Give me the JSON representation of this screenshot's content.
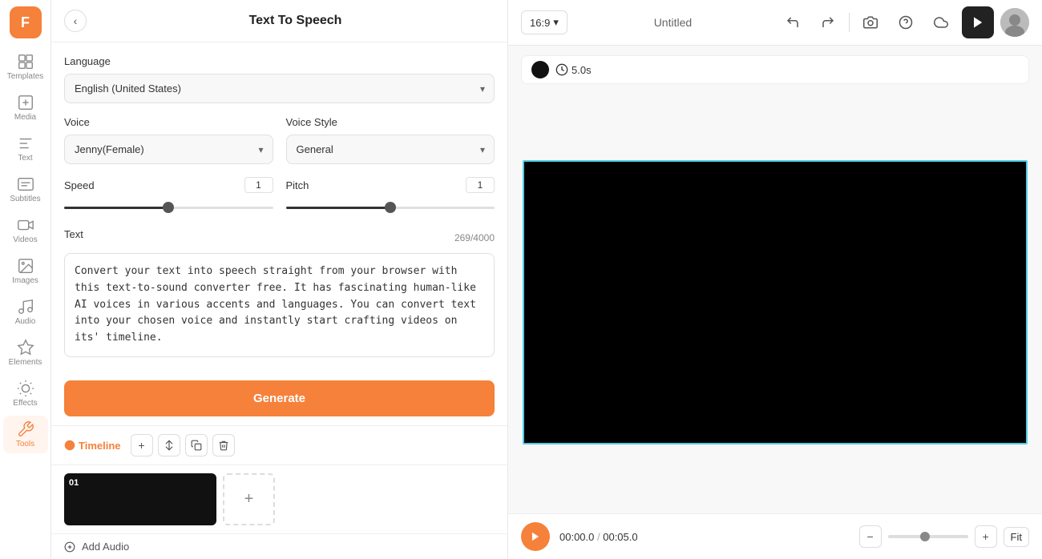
{
  "app": {
    "logo": "F"
  },
  "sidebar": {
    "items": [
      {
        "id": "templates",
        "label": "Templates",
        "icon": "grid"
      },
      {
        "id": "media",
        "label": "Media",
        "icon": "plus-square"
      },
      {
        "id": "text",
        "label": "Text",
        "icon": "text"
      },
      {
        "id": "subtitles",
        "label": "Subtitles",
        "icon": "subtitles"
      },
      {
        "id": "videos",
        "label": "Videos",
        "icon": "video"
      },
      {
        "id": "images",
        "label": "Images",
        "icon": "image"
      },
      {
        "id": "audio",
        "label": "Audio",
        "icon": "music"
      },
      {
        "id": "elements",
        "label": "Elements",
        "icon": "elements"
      },
      {
        "id": "effects",
        "label": "Effects",
        "icon": "effects"
      },
      {
        "id": "tools",
        "label": "Tools",
        "icon": "tools",
        "active": true
      }
    ]
  },
  "panel": {
    "title": "Text To Speech",
    "back_label": "‹",
    "language_label": "Language",
    "language_value": "English (United States)",
    "voice_label": "Voice",
    "voice_value": "Jenny(Female)",
    "voice_style_label": "Voice Style",
    "voice_style_value": "General",
    "speed_label": "Speed",
    "speed_value": "1",
    "pitch_label": "Pitch",
    "pitch_value": "1",
    "text_label": "Text",
    "char_count": "269/4000",
    "text_value": "Convert your text into speech straight from your browser with this text-to-sound converter free. It has fascinating human-like AI voices in various accents and languages. You can convert text into your chosen voice and instantly start crafting videos on its' timeline.",
    "generate_label": "Generate"
  },
  "timeline": {
    "label": "Timeline",
    "clips": [
      {
        "id": "01",
        "number": "01"
      }
    ],
    "add_audio_label": "Add Audio"
  },
  "topbar": {
    "aspect_ratio": "16:9",
    "title": "Untitled",
    "publish_icon": "▶"
  },
  "preview": {
    "time": "5.0s"
  },
  "playback": {
    "current_time": "00:00.0",
    "total_time": "00:05.0",
    "separator": "/",
    "fit_label": "Fit"
  }
}
